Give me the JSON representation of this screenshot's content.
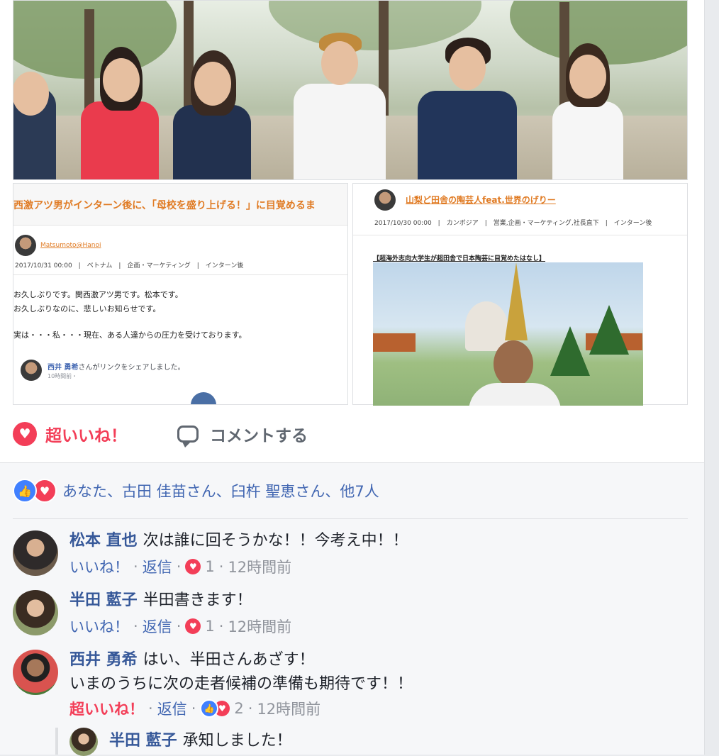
{
  "colors": {
    "love": "#f33e58",
    "like": "#4080ff",
    "link": "#365899",
    "meta": "#90949c",
    "orange": "#e07b24"
  },
  "thumbnails": {
    "left": {
      "title": "西激アツ男がインターン後に、「母校を盛り上げる！」に目覚めるま",
      "author": "Matsumoto@Hanoi",
      "meta": "2017/10/31 00:00　|　ベトナム　|　企画・マーケティング　|　インターン後",
      "body": [
        "お久しぶりです。関西激アツ男です。松本です。",
        "お久しぶりなのに、悲しいお知らせです。",
        "実は・・・私・・・現在、ある人達からの圧力を受けております。"
      ],
      "share_name": "西井 勇希",
      "share_rest": "さんがリンクをシェアしました。",
      "share_time": "10時間前・"
    },
    "right": {
      "title": "山梨ど田舎の陶芸人feat.世界のげりー",
      "meta": "2017/10/30 00:00　|　カンボジア　|　営業,企画・マーケティング,社長直下　|　インターン後",
      "heading": "【超海外志向大学生が超田舎で日本陶芸に目覚めたはなし】"
    }
  },
  "actions": {
    "love_label": "超いいね！",
    "comment_label": "コメントする",
    "love_icon": "heart-icon",
    "comment_icon": "comment-bubble-icon"
  },
  "reactions_summary": "あなた、古田 佳苗さん、臼杵 聖恵さん、他7人",
  "comments": [
    {
      "name": "松本 直也",
      "text": "次は誰に回そうかな！！今考え中！！",
      "like_label": "いいね！",
      "reply_label": "返信",
      "reaction_count": "1",
      "time": "12時間前"
    },
    {
      "name": "半田 藍子",
      "text": "半田書きます！",
      "like_label": "いいね！",
      "reply_label": "返信",
      "reaction_count": "1",
      "time": "12時間前"
    },
    {
      "name": "西井 勇希",
      "text": "はい、半田さんあざす！",
      "text2": "いまのうちに次の走者候補の準備も期待です！！",
      "like_label": "超いいね！",
      "reply_label": "返信",
      "reaction_count": "2",
      "time": "12時間前"
    }
  ],
  "reply": {
    "name": "半田 藍子",
    "text": "承知しました！"
  }
}
